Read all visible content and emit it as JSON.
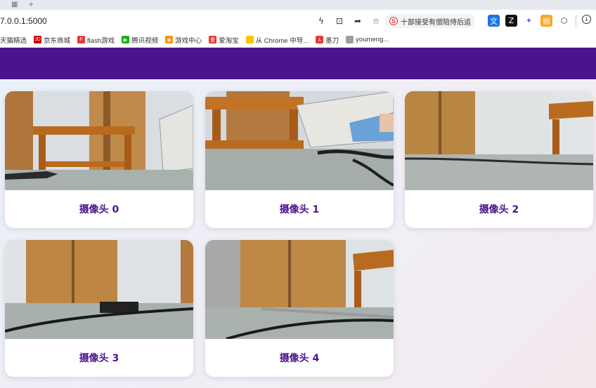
{
  "browser": {
    "url": "7.0.0.1:5000",
    "search_text": "十部接受有偿陪侍后追",
    "search_logo": "S",
    "bookmarks": [
      {
        "label": "天猫精选",
        "icon": "tmall-icon",
        "color": "#ff4400",
        "glyph": ""
      },
      {
        "label": "京东商城",
        "icon": "jd-icon",
        "color": "#c40000",
        "glyph": "JD"
      },
      {
        "label": "flash游戏",
        "icon": "flash-game-icon",
        "color": "#e53935",
        "glyph": "F"
      },
      {
        "label": "腾讯视频",
        "icon": "tencent-video-icon",
        "color": "#1aad19",
        "glyph": "▶"
      },
      {
        "label": "游戏中心",
        "icon": "game-center-icon",
        "color": "#ff8f00",
        "glyph": "◉"
      },
      {
        "label": "爱淘宝",
        "icon": "aitaobao-icon",
        "color": "#e53935",
        "glyph": "爱"
      },
      {
        "label": "从 Chrome 中导...",
        "icon": "folder-icon",
        "color": "#f9c400",
        "glyph": ""
      },
      {
        "label": "墨刀",
        "icon": "modao-icon",
        "color": "#e53935",
        "glyph": "⅄"
      },
      {
        "label": "youmeng...",
        "icon": "page-icon",
        "color": "#9e9e9e",
        "glyph": ""
      }
    ]
  },
  "header": {
    "color": "#4a148c"
  },
  "cameras": [
    {
      "label": "摄像头 0",
      "scene": "chair-bed"
    },
    {
      "label": "摄像头 1",
      "scene": "bed-person"
    },
    {
      "label": "摄像头 2",
      "scene": "cabinet-chair"
    },
    {
      "label": "摄像头 3",
      "scene": "cabinet-table"
    },
    {
      "label": "摄像头 4",
      "scene": "cabinet-chair-right"
    }
  ]
}
